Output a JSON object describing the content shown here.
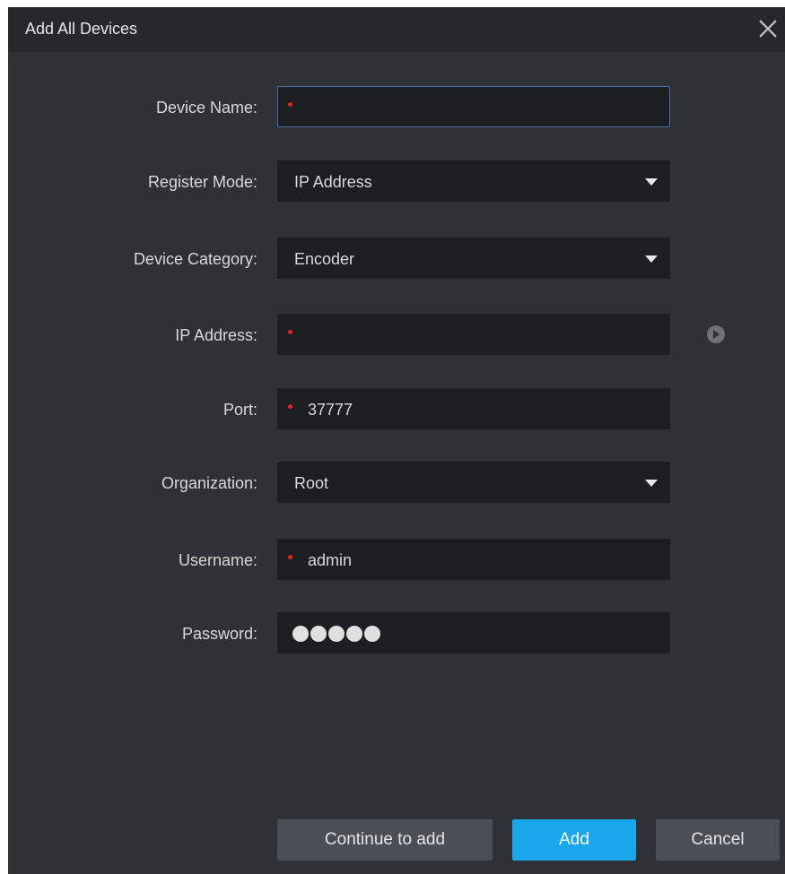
{
  "dialog": {
    "title": "Add All Devices",
    "close_icon": "close-icon"
  },
  "form": {
    "device_name": {
      "label": "Device Name:",
      "value": "",
      "required": true
    },
    "register_mode": {
      "label": "Register Mode:",
      "value": "IP Address"
    },
    "device_category": {
      "label": "Device Category:",
      "value": "Encoder"
    },
    "ip_address": {
      "label": "IP Address:",
      "value": "",
      "required": true,
      "action_icon": "play-circle-icon"
    },
    "port": {
      "label": "Port:",
      "value": "37777",
      "required": true
    },
    "organization": {
      "label": "Organization:",
      "value": "Root"
    },
    "username": {
      "label": "Username:",
      "value": "admin",
      "required": true
    },
    "password": {
      "label": "Password:",
      "masked_length": 5
    }
  },
  "buttons": {
    "continue_label": "Continue to add",
    "add_label": "Add",
    "cancel_label": "Cancel"
  },
  "colors": {
    "dialog_bg": "#2e3135",
    "titlebar_bg": "#25282c",
    "field_bg": "#1c1e21",
    "required_marker": "#e5221e",
    "primary_button": "#1aa7ec",
    "secondary_button": "#4a4f55"
  }
}
